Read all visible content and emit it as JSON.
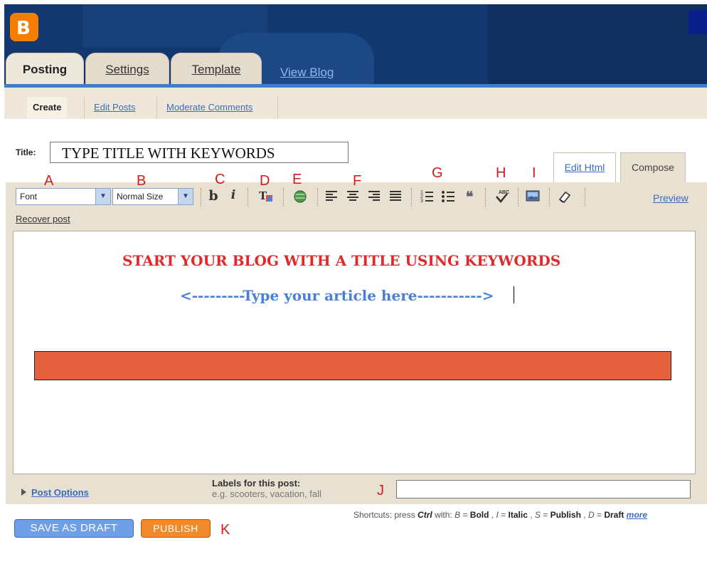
{
  "app": {
    "logo_glyph": "B"
  },
  "tabs": [
    {
      "label": "Posting"
    },
    {
      "label": "Settings"
    },
    {
      "label": "Template"
    },
    {
      "label": "View Blog"
    }
  ],
  "subtabs": [
    {
      "label": "Create"
    },
    {
      "label": "Edit Posts"
    },
    {
      "label": "Moderate Comments"
    }
  ],
  "title_field": {
    "label": "Title:",
    "value": "TYPE  TITLE WITH KEYWORDS"
  },
  "mode_tabs": {
    "edit_html": "Edit Html",
    "compose": "Compose"
  },
  "toolbar": {
    "font": "Font",
    "size": "Normal Size",
    "bold": "b",
    "italic": "i",
    "preview": "Preview",
    "recover": "Recover post"
  },
  "annotations": {
    "A": "A",
    "B": "B",
    "C": "C",
    "D": "D",
    "E": "E",
    "F": "F",
    "G": "G",
    "H": "H",
    "I": "I",
    "J": "J",
    "K": "K"
  },
  "content": {
    "headline": "START YOUR BLOG WITH A TITLE USING KEYWORDS",
    "article": "<---------Type your article here----------->"
  },
  "labels": {
    "post_options": "Post Options",
    "title": "Labels for this post:",
    "example": "e.g. scooters, vacation, fall",
    "value": ""
  },
  "shortcuts": {
    "prefix": "Shortcuts: press",
    "ctrl": "Ctrl",
    "with": "with:",
    "b_key": "B",
    "b_label": "Bold",
    "i_key": "I",
    "i_label": "Italic",
    "s_key": "S",
    "s_label": "Publish",
    "d_key": "D",
    "d_label": "Draft",
    "more": "more"
  },
  "buttons": {
    "save_draft": "SAVE AS DRAFT",
    "publish": "PUBLISH"
  },
  "colors": {
    "header": "#12386f",
    "accent_blue": "#3d7fcf",
    "annotation_red": "#d21b1b",
    "redbar": "#e5613d",
    "publish": "#f08a2a",
    "draft": "#6f9fe6"
  }
}
